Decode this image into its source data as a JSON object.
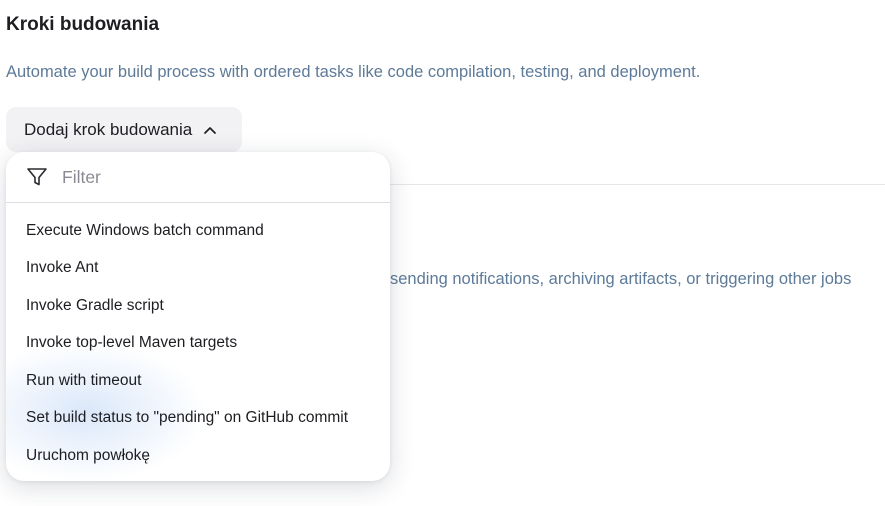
{
  "section": {
    "title": "Kroki budowania",
    "description": "Automate your build process with ordered tasks like code compilation, testing, and deployment.",
    "add_button_label": "Dodaj krok budowania"
  },
  "post_build": {
    "description_visible": "sending notifications, archiving artifacts, or triggering other jobs"
  },
  "dropdown": {
    "filter_placeholder": "Filter",
    "filter_value": "",
    "items": [
      {
        "label": "Execute Windows batch command"
      },
      {
        "label": "Invoke Ant"
      },
      {
        "label": "Invoke Gradle script"
      },
      {
        "label": "Invoke top-level Maven targets"
      },
      {
        "label": "Run with timeout"
      },
      {
        "label": "Set build status to \"pending\" on GitHub commit"
      },
      {
        "label": "Uruchom powłokę"
      }
    ]
  },
  "icons": {
    "button_chevron": "chevron-up-icon",
    "filter": "funnel-icon"
  },
  "colors": {
    "description_text": "#5d7a99",
    "button_background": "#f2f2f4"
  }
}
